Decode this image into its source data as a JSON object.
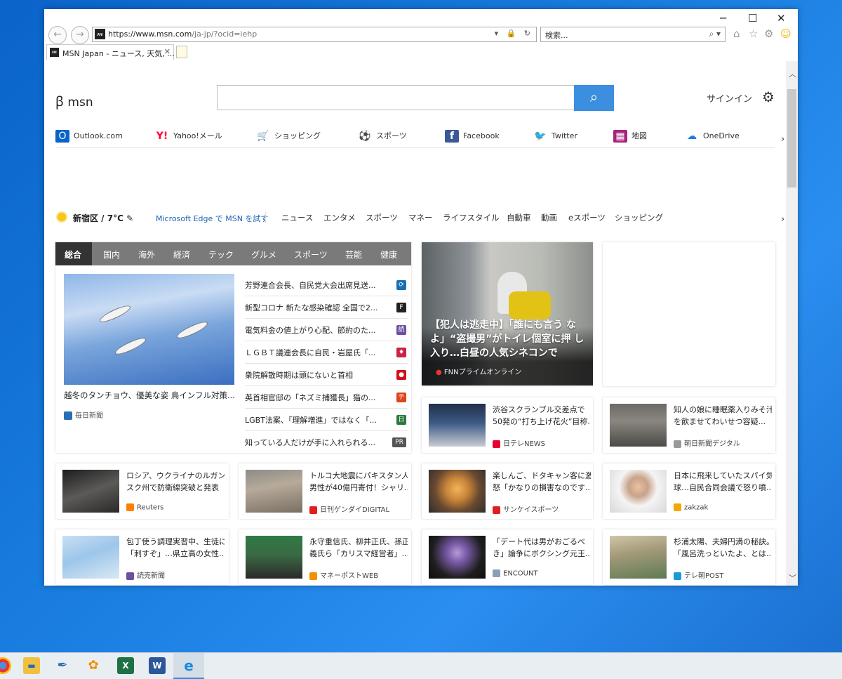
{
  "browser": {
    "url_host": "https://www.msn.com",
    "url_rest": "/ja-jp/?ocid=iehp",
    "search_placeholder": "検索...",
    "tab_title": "MSN Japan - ニュース, 天気, ..."
  },
  "header": {
    "logo_text": "msn",
    "signin": "サインイン"
  },
  "quick_links": [
    {
      "label": "Outlook.com",
      "icon": "outlook-icon",
      "color": "#0a64c8"
    },
    {
      "label": "Yahoo!メール",
      "icon": "yahoo-icon",
      "color": "#ff0033"
    },
    {
      "label": "ショッピング",
      "icon": "cart-icon",
      "color": "#1e50c8"
    },
    {
      "label": "スポーツ",
      "icon": "sports-icon",
      "color": "#5a4aa6"
    },
    {
      "label": "Facebook",
      "icon": "facebook-icon",
      "color": "#3b5998"
    },
    {
      "label": "Twitter",
      "icon": "twitter-icon",
      "color": "#1da1f2"
    },
    {
      "label": "地図",
      "icon": "map-icon",
      "color": "#a8237e"
    },
    {
      "label": "OneDrive",
      "icon": "onedrive-icon",
      "color": "#1c7fe0"
    }
  ],
  "navbar": {
    "weather": "新宿区 / 7°C",
    "edge_link": "Microsoft Edge で MSN を試す",
    "items": [
      "ニュース",
      "エンタメ",
      "スポーツ",
      "マネー",
      "ライフスタイル",
      "自動車",
      "動画",
      "eスポーツ",
      "ショッピング"
    ]
  },
  "news_tabs": [
    "総合",
    "国内",
    "海外",
    "経済",
    "テック",
    "グルメ",
    "スポーツ",
    "芸能",
    "健康"
  ],
  "hero": {
    "caption": "越冬のタンチョウ、優美な姿 鳥インフル対策...",
    "source": "毎日新聞"
  },
  "headlines": [
    {
      "text": "芳野連合会長、自民党大会出席見送...",
      "color": "#1a6fb3",
      "icon_text": "⟳"
    },
    {
      "text": "新型コロナ 新たな感染確認 全国で2...",
      "color": "#222222",
      "icon_text": "F"
    },
    {
      "text": "電気料金の値上がり心配、節約のた...",
      "color": "#6b4fa0",
      "icon_text": "読"
    },
    {
      "text": "ＬＧＢＴ議連会長に自民・岩屋氏「...",
      "color": "#cc2244",
      "icon_text": "♦"
    },
    {
      "text": "衆院解散時期は頭にないと首相",
      "color": "#d0101a",
      "icon_text": "●"
    },
    {
      "text": "英首相官邸の「ネズミ捕獲長」猫の...",
      "color": "#e0441a",
      "icon_text": "テ"
    },
    {
      "text": "LGBT法案、「理解増進」ではなく「...",
      "color": "#2a7a3a",
      "icon_text": "日"
    },
    {
      "text": "知っている人だけが手に入れられる...",
      "color": "#555555",
      "icon_text": "PR"
    }
  ],
  "featured": {
    "headline": "【犯人は逃走中】「誰にも言う なよ」“盗撮男”がトイレ個室に押 し入り…白昼の人気シネコンで",
    "source": "FNNプライムオンライン"
  },
  "cards": [
    {
      "l1": "渋谷スクランブル交差点で",
      "l2": "50発の“打ち上げ花火”目称...",
      "source": "日テレNEWS",
      "color": "#e60033"
    },
    {
      "l1": "知人の娘に睡眠薬入りみそ汁",
      "l2": "を飲ませてわいせつ容疑...",
      "source": "朝日新聞デジタル",
      "color": "#999999"
    },
    {
      "l1": "ロシア、ウクライナのルガン",
      "l2": "スク州で防衛線突破と発表",
      "source": "Reuters",
      "color": "#ff8000"
    },
    {
      "l1": "トルコ大地震にパキスタン人",
      "l2": "男性が40億円寄付！シャリ...",
      "source": "日刊ゲンダイDIGITAL",
      "color": "#e02020"
    },
    {
      "l1": "楽しんご、ドタキャン客に激",
      "l2": "怒「かなりの損害なのです...",
      "source": "サンケイスポーツ",
      "color": "#e02020"
    },
    {
      "l1": "日本に飛来していたスパイ気",
      "l2": "球…自民合同会議で怒り噴...",
      "source": "zakzak",
      "color": "#f2a800"
    },
    {
      "l1": "包丁使う調理実習中、生徒に",
      "l2": "「刺すぞ」…県立高の女性...",
      "source": "読売新聞",
      "color": "#6b4fa0"
    },
    {
      "l1": "永守重信氏、柳井正氏、孫正",
      "l2": "義氏ら「カリスマ経営者」...",
      "source": "マネーポストWEB",
      "color": "#f29000"
    },
    {
      "l1": "「デート代は男がおごるべ",
      "l2": "き」論争にボクシング元王...",
      "source": "ENCOUNT",
      "color": "#8aa0b8"
    },
    {
      "l1": "杉浦太陽、夫婦円満の秘訣。",
      "l2": "「風呂洗っといたよ、とは...",
      "source": "テレ朝POST",
      "color": "#1a9ad6"
    }
  ],
  "taskbar": [
    "chrome-icon",
    "file-explorer-icon",
    "pen-app-icon",
    "paint-app-icon",
    "excel-icon",
    "word-icon",
    "internet-explorer-icon"
  ]
}
